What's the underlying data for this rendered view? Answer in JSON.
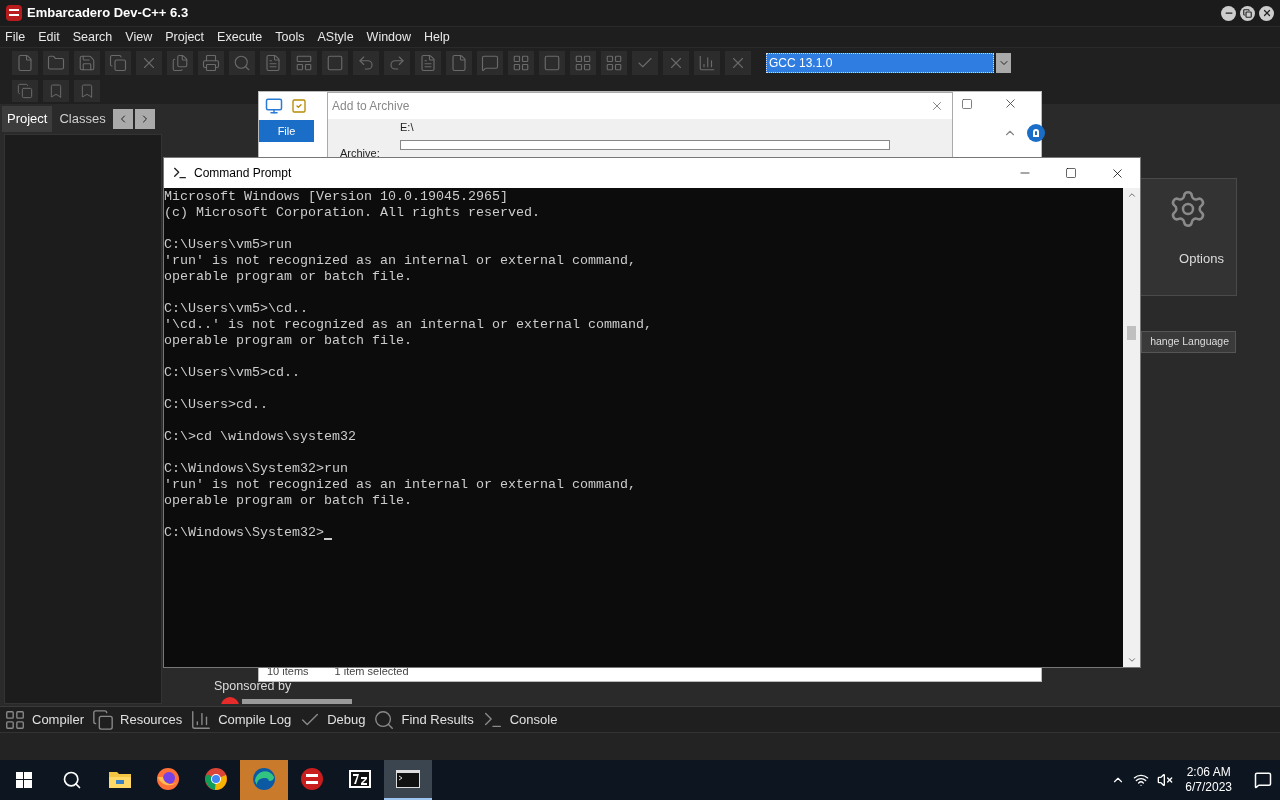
{
  "ide": {
    "title": "Embarcadero Dev-C++ 6.3",
    "menu": [
      "File",
      "Edit",
      "Search",
      "View",
      "Project",
      "Execute",
      "Tools",
      "AStyle",
      "Window",
      "Help"
    ],
    "compiler": "GCC 13.1.0",
    "panel_tabs": [
      {
        "label": "Project",
        "selected": true
      },
      {
        "label": "Classes",
        "selected": false
      }
    ],
    "options_label": "Options",
    "language_button": "hange Language",
    "sponsor": "Sponsored by",
    "bottom_tabs": [
      {
        "label": "Compiler",
        "kind": "grid"
      },
      {
        "label": "Resources",
        "kind": "copy"
      },
      {
        "label": "Compile Log",
        "kind": "chart"
      },
      {
        "label": "Debug",
        "kind": "check"
      },
      {
        "label": "Find Results",
        "kind": "search"
      },
      {
        "label": "Console",
        "kind": "console"
      }
    ]
  },
  "archiver": {
    "title": "Add to Archive",
    "ribbon_tab": "File",
    "archive_label": "Archive:",
    "path": "E:\\",
    "status": [
      "10 items",
      "1 item selected"
    ]
  },
  "console": {
    "title": "Command Prompt",
    "blocks": [
      [
        "Microsoft Windows [Version 10.0.19045.2965]",
        "(c) Microsoft Corporation. All rights reserved."
      ],
      [
        "C:\\Users\\vm5>run",
        "'run' is not recognized as an internal or external command,",
        "operable program or batch file."
      ],
      [
        "C:\\Users\\vm5>\\cd..",
        "'\\cd..' is not recognized as an internal or external command,",
        "operable program or batch file."
      ],
      [
        "C:\\Users\\vm5>cd.."
      ],
      [
        "C:\\Users>cd.."
      ],
      [
        "C:\\>cd \\windows\\system32"
      ],
      [
        "C:\\Windows\\System32>run",
        "'run' is not recognized as an internal or external command,",
        "operable program or batch file."
      ],
      [
        "C:\\Windows\\System32>"
      ]
    ]
  },
  "taskbar": {
    "apps": [
      {
        "kind": "explorer",
        "selected": false,
        "hovered": false
      },
      {
        "kind": "firefox",
        "selected": false,
        "hovered": false
      },
      {
        "kind": "chrome",
        "selected": false,
        "hovered": false
      },
      {
        "kind": "edge",
        "selected": false,
        "hovered": true
      },
      {
        "kind": "devcpp",
        "selected": false,
        "hovered": false
      },
      {
        "kind": "sevenzip",
        "selected": false,
        "hovered": false
      },
      {
        "kind": "cmd",
        "selected": true,
        "hovered": false
      }
    ],
    "time": "2:06 AM",
    "date": "6/7/2023"
  }
}
